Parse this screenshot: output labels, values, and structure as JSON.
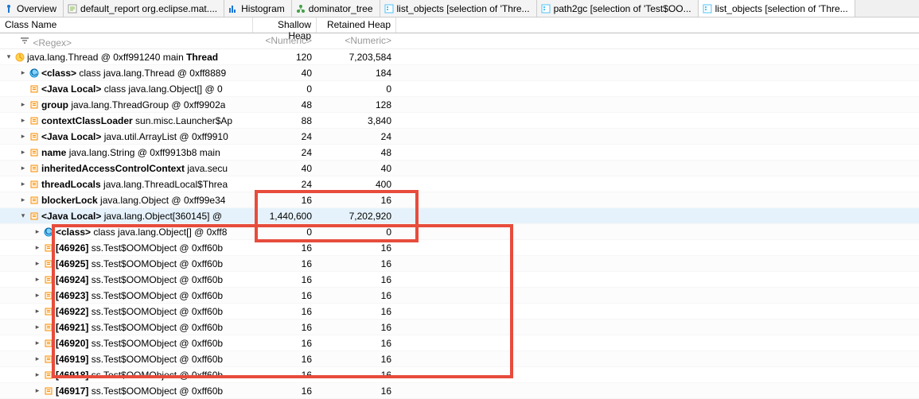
{
  "tabs": [
    {
      "label": "Overview"
    },
    {
      "label": "default_report  org.eclipse.mat...."
    },
    {
      "label": "Histogram"
    },
    {
      "label": "dominator_tree"
    },
    {
      "label": "list_objects [selection of 'Thre..."
    },
    {
      "label": "path2gc [selection of 'Test$OO..."
    },
    {
      "label": "list_objects [selection of 'Thre..."
    }
  ],
  "columns": {
    "class": "Class Name",
    "shallow": "Shallow Heap",
    "retained": "Retained Heap"
  },
  "filters": {
    "regex": "<Regex>",
    "numeric": "<Numeric>"
  },
  "rows": [
    {
      "indent": 0,
      "tw": "v",
      "icon": "thread",
      "html": "java.lang.Thread @ 0xff991240  main <b>Thread</b>",
      "sh": "120",
      "rt": "7,203,584"
    },
    {
      "indent": 1,
      "tw": ">",
      "icon": "class",
      "html": "<b>&lt;class&gt;</b> class java.lang.Thread @ 0xff8889",
      "sh": "40",
      "rt": "184"
    },
    {
      "indent": 1,
      "tw": "",
      "icon": "obj",
      "html": "<b>&lt;Java Local&gt;</b> class java.lang.Object[] @ 0",
      "sh": "0",
      "rt": "0"
    },
    {
      "indent": 1,
      "tw": ">",
      "icon": "obj",
      "html": "<b>group</b> java.lang.ThreadGroup @ 0xff9902a",
      "sh": "48",
      "rt": "128"
    },
    {
      "indent": 1,
      "tw": ">",
      "icon": "obj",
      "html": "<b>contextClassLoader</b> sun.misc.Launcher$Ap",
      "sh": "88",
      "rt": "3,840"
    },
    {
      "indent": 1,
      "tw": ">",
      "icon": "obj",
      "html": "<b>&lt;Java Local&gt;</b> java.util.ArrayList @ 0xff9910",
      "sh": "24",
      "rt": "24"
    },
    {
      "indent": 1,
      "tw": ">",
      "icon": "obj",
      "html": "<b>name</b> java.lang.String @ 0xff9913b8  main",
      "sh": "24",
      "rt": "48"
    },
    {
      "indent": 1,
      "tw": ">",
      "icon": "obj",
      "html": "<b>inheritedAccessControlContext</b> java.secu",
      "sh": "40",
      "rt": "40"
    },
    {
      "indent": 1,
      "tw": ">",
      "icon": "obj",
      "html": "<b>threadLocals</b> java.lang.ThreadLocal$Threa",
      "sh": "24",
      "rt": "400"
    },
    {
      "indent": 1,
      "tw": ">",
      "icon": "obj",
      "html": "<b>blockerLock</b> java.lang.Object @ 0xff99e34",
      "sh": "16",
      "rt": "16"
    },
    {
      "indent": 1,
      "tw": "v",
      "icon": "obj",
      "html": "<b>&lt;Java Local&gt;</b> java.lang.Object[360145] @",
      "sh": "1,440,600",
      "rt": "7,202,920",
      "selected": true
    },
    {
      "indent": 2,
      "tw": ">",
      "icon": "class",
      "html": "<b>&lt;class&gt;</b> class java.lang.Object[] @ 0xff8",
      "sh": "0",
      "rt": "0"
    },
    {
      "indent": 2,
      "tw": ">",
      "icon": "obj",
      "html": "<b>[46926]</b> ss.Test$OOMObject @ 0xff60b",
      "sh": "16",
      "rt": "16"
    },
    {
      "indent": 2,
      "tw": ">",
      "icon": "obj",
      "html": "<b>[46925]</b> ss.Test$OOMObject @ 0xff60b",
      "sh": "16",
      "rt": "16"
    },
    {
      "indent": 2,
      "tw": ">",
      "icon": "obj",
      "html": "<b>[46924]</b> ss.Test$OOMObject @ 0xff60b",
      "sh": "16",
      "rt": "16"
    },
    {
      "indent": 2,
      "tw": ">",
      "icon": "obj",
      "html": "<b>[46923]</b> ss.Test$OOMObject @ 0xff60b",
      "sh": "16",
      "rt": "16"
    },
    {
      "indent": 2,
      "tw": ">",
      "icon": "obj",
      "html": "<b>[46922]</b> ss.Test$OOMObject @ 0xff60b",
      "sh": "16",
      "rt": "16"
    },
    {
      "indent": 2,
      "tw": ">",
      "icon": "obj",
      "html": "<b>[46921]</b> ss.Test$OOMObject @ 0xff60b",
      "sh": "16",
      "rt": "16"
    },
    {
      "indent": 2,
      "tw": ">",
      "icon": "obj",
      "html": "<b>[46920]</b> ss.Test$OOMObject @ 0xff60b",
      "sh": "16",
      "rt": "16"
    },
    {
      "indent": 2,
      "tw": ">",
      "icon": "obj",
      "html": "<b>[46919]</b> ss.Test$OOMObject @ 0xff60b",
      "sh": "16",
      "rt": "16"
    },
    {
      "indent": 2,
      "tw": ">",
      "icon": "obj",
      "html": "<b>[46918]</b> ss.Test$OOMObject @ 0xff60b",
      "sh": "16",
      "rt": "16"
    },
    {
      "indent": 2,
      "tw": ">",
      "icon": "obj",
      "html": "<b>[46917]</b> ss.Test$OOMObject @ 0xff60b",
      "sh": "16",
      "rt": "16"
    }
  ]
}
